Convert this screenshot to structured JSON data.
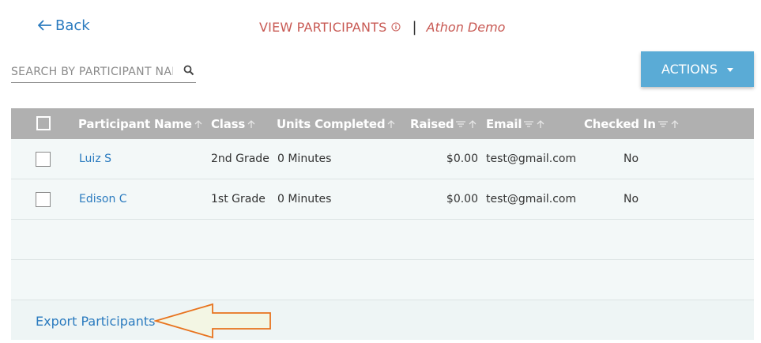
{
  "nav": {
    "back_label": "Back"
  },
  "header": {
    "page_title": "VIEW PARTICIPANTS",
    "event_name": "Athon Demo"
  },
  "search": {
    "placeholder": "SEARCH BY PARTICIPANT NAME"
  },
  "actions": {
    "label": "ACTIONS"
  },
  "table": {
    "columns": [
      "Participant Name",
      "Class",
      "Units Completed",
      "Raised",
      "Email",
      "Checked In"
    ],
    "rows": [
      {
        "name": "Luiz S",
        "class": "2nd Grade",
        "units": "0 Minutes",
        "raised": "$0.00",
        "email": "test@gmail.com",
        "checked_in": "No"
      },
      {
        "name": "Edison C",
        "class": "1st Grade",
        "units": "0 Minutes",
        "raised": "$0.00",
        "email": "test@gmail.com",
        "checked_in": "No"
      }
    ]
  },
  "footer": {
    "export_label": "Export Participants"
  },
  "colors": {
    "link": "#2b7bbf",
    "title": "#c85a54",
    "header_bg": "#b0b0b0",
    "button": "#5aabd6",
    "arrow_stroke": "#e8731e",
    "arrow_fill": "#f3f6e4"
  }
}
